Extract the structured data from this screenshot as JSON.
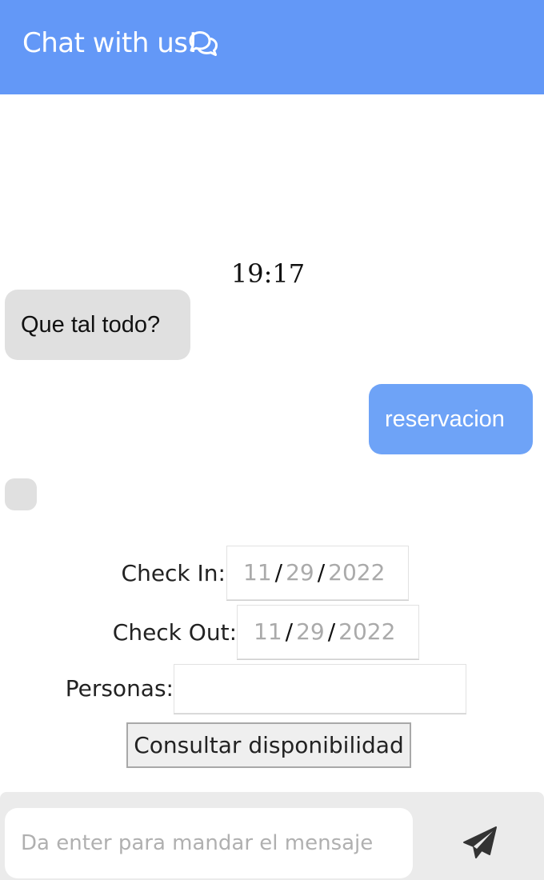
{
  "header": {
    "title": "Chat with us!",
    "icon": "comments-icon",
    "background_color": "#6398f7"
  },
  "chat": {
    "timestamp": "19:17",
    "messages": [
      {
        "from": "bot",
        "text": "Que tal todo?"
      },
      {
        "from": "user",
        "text": "reservacion"
      },
      {
        "from": "bot",
        "text": ""
      }
    ],
    "user_bubble_color": "#6ea3f7",
    "bot_bubble_color": "#e0e0e0"
  },
  "form": {
    "check_in": {
      "label": "Check In:",
      "month": "11",
      "day": "29",
      "year": "2022"
    },
    "check_out": {
      "label": "Check Out:",
      "month": "11",
      "day": "29",
      "year": "2022"
    },
    "personas": {
      "label": "Personas:",
      "value": ""
    },
    "submit_label": "Consultar disponibilidad"
  },
  "composer": {
    "placeholder": "Da enter para mandar el mensaje",
    "send_icon": "send-icon"
  }
}
